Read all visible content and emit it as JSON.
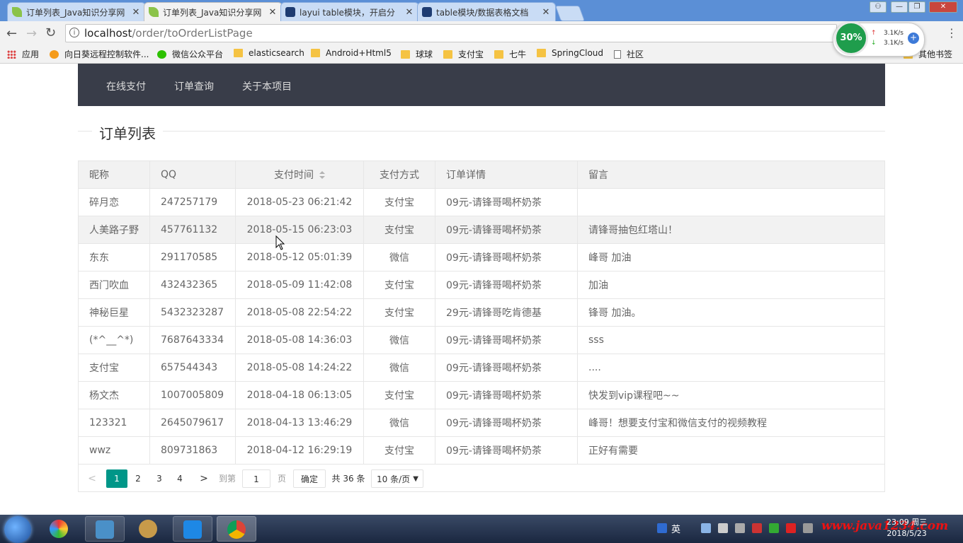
{
  "browser": {
    "tabs": [
      {
        "title": "订单列表_Java知识分享网",
        "active": false
      },
      {
        "title": "订单列表_Java知识分享网",
        "active": true
      },
      {
        "title": "layui table模块，开启分",
        "active": false
      },
      {
        "title": "table模块/数据表格文档",
        "active": false
      }
    ],
    "tab_close": "✕",
    "url_host": "localhost",
    "url_path": "/order/toOrderListPage",
    "bookmarks": [
      "应用",
      "向日葵远程控制软件...",
      "微信公众平台",
      "elasticsearch",
      "Android+Html5",
      "球球",
      "支付宝",
      "七牛",
      "SpringCloud",
      "社区"
    ],
    "other_bookmarks": "其他书签",
    "speed": {
      "percent": "30%",
      "up": "3.1K/s",
      "down": "3.1K/s"
    }
  },
  "nav": {
    "items": [
      "在线支付",
      "订单查询",
      "关于本项目"
    ]
  },
  "page_title": "订单列表",
  "table": {
    "columns": [
      "昵称",
      "QQ",
      "支付时间",
      "支付方式",
      "订单详情",
      "留言"
    ],
    "rows": [
      [
        "碎月恋",
        "247257179",
        "2018-05-23 06:21:42",
        "支付宝",
        "09元-请锋哥喝杯奶茶",
        ""
      ],
      [
        "人美路子野",
        "457761132",
        "2018-05-15 06:23:03",
        "支付宝",
        "09元-请锋哥喝杯奶茶",
        "请锋哥抽包红塔山！"
      ],
      [
        "东东",
        "291170585",
        "2018-05-12 05:01:39",
        "微信",
        "09元-请锋哥喝杯奶茶",
        "峰哥 加油"
      ],
      [
        "西门吹血",
        "432432365",
        "2018-05-09 11:42:08",
        "支付宝",
        "09元-请锋哥喝杯奶茶",
        "加油"
      ],
      [
        "神秘巨星",
        "5432323287",
        "2018-05-08 22:54:22",
        "支付宝",
        "29元-请锋哥吃肯德基",
        "锋哥 加油。"
      ],
      [
        "(*^__^*)",
        "7687643334",
        "2018-05-08 14:36:03",
        "微信",
        "09元-请锋哥喝杯奶茶",
        "sss"
      ],
      [
        "支付宝",
        "657544343",
        "2018-05-08 14:24:22",
        "微信",
        "09元-请锋哥喝杯奶茶",
        "...."
      ],
      [
        "杨文杰",
        "1007005809",
        "2018-04-18 06:13:05",
        "支付宝",
        "09元-请锋哥喝杯奶茶",
        "快发到vip课程吧~~"
      ],
      [
        "123321",
        "2645079617",
        "2018-04-13 13:46:29",
        "微信",
        "09元-请锋哥喝杯奶茶",
        "峰哥！想要支付宝和微信支付的视频教程"
      ],
      [
        "wwz",
        "809731863",
        "2018-04-12 16:29:19",
        "支付宝",
        "09元-请锋哥喝杯奶茶",
        "正好有需要"
      ]
    ],
    "hover_row": 1
  },
  "pager": {
    "pages": [
      "1",
      "2",
      "3",
      "4"
    ],
    "current": "1",
    "goto_label": "到第",
    "goto_value": "1",
    "page_unit": "页",
    "confirm": "确定",
    "total": "共 36 条",
    "page_size": "10 条/页"
  },
  "taskbar": {
    "ime": "英",
    "clock_time": "23:09 周三",
    "clock_date": "2018/5/23",
    "watermark": "www.java1234.com"
  },
  "colors": {
    "nav_bg": "#393d49",
    "pager_active": "#009688",
    "speed_green": "#1f9d4c"
  }
}
